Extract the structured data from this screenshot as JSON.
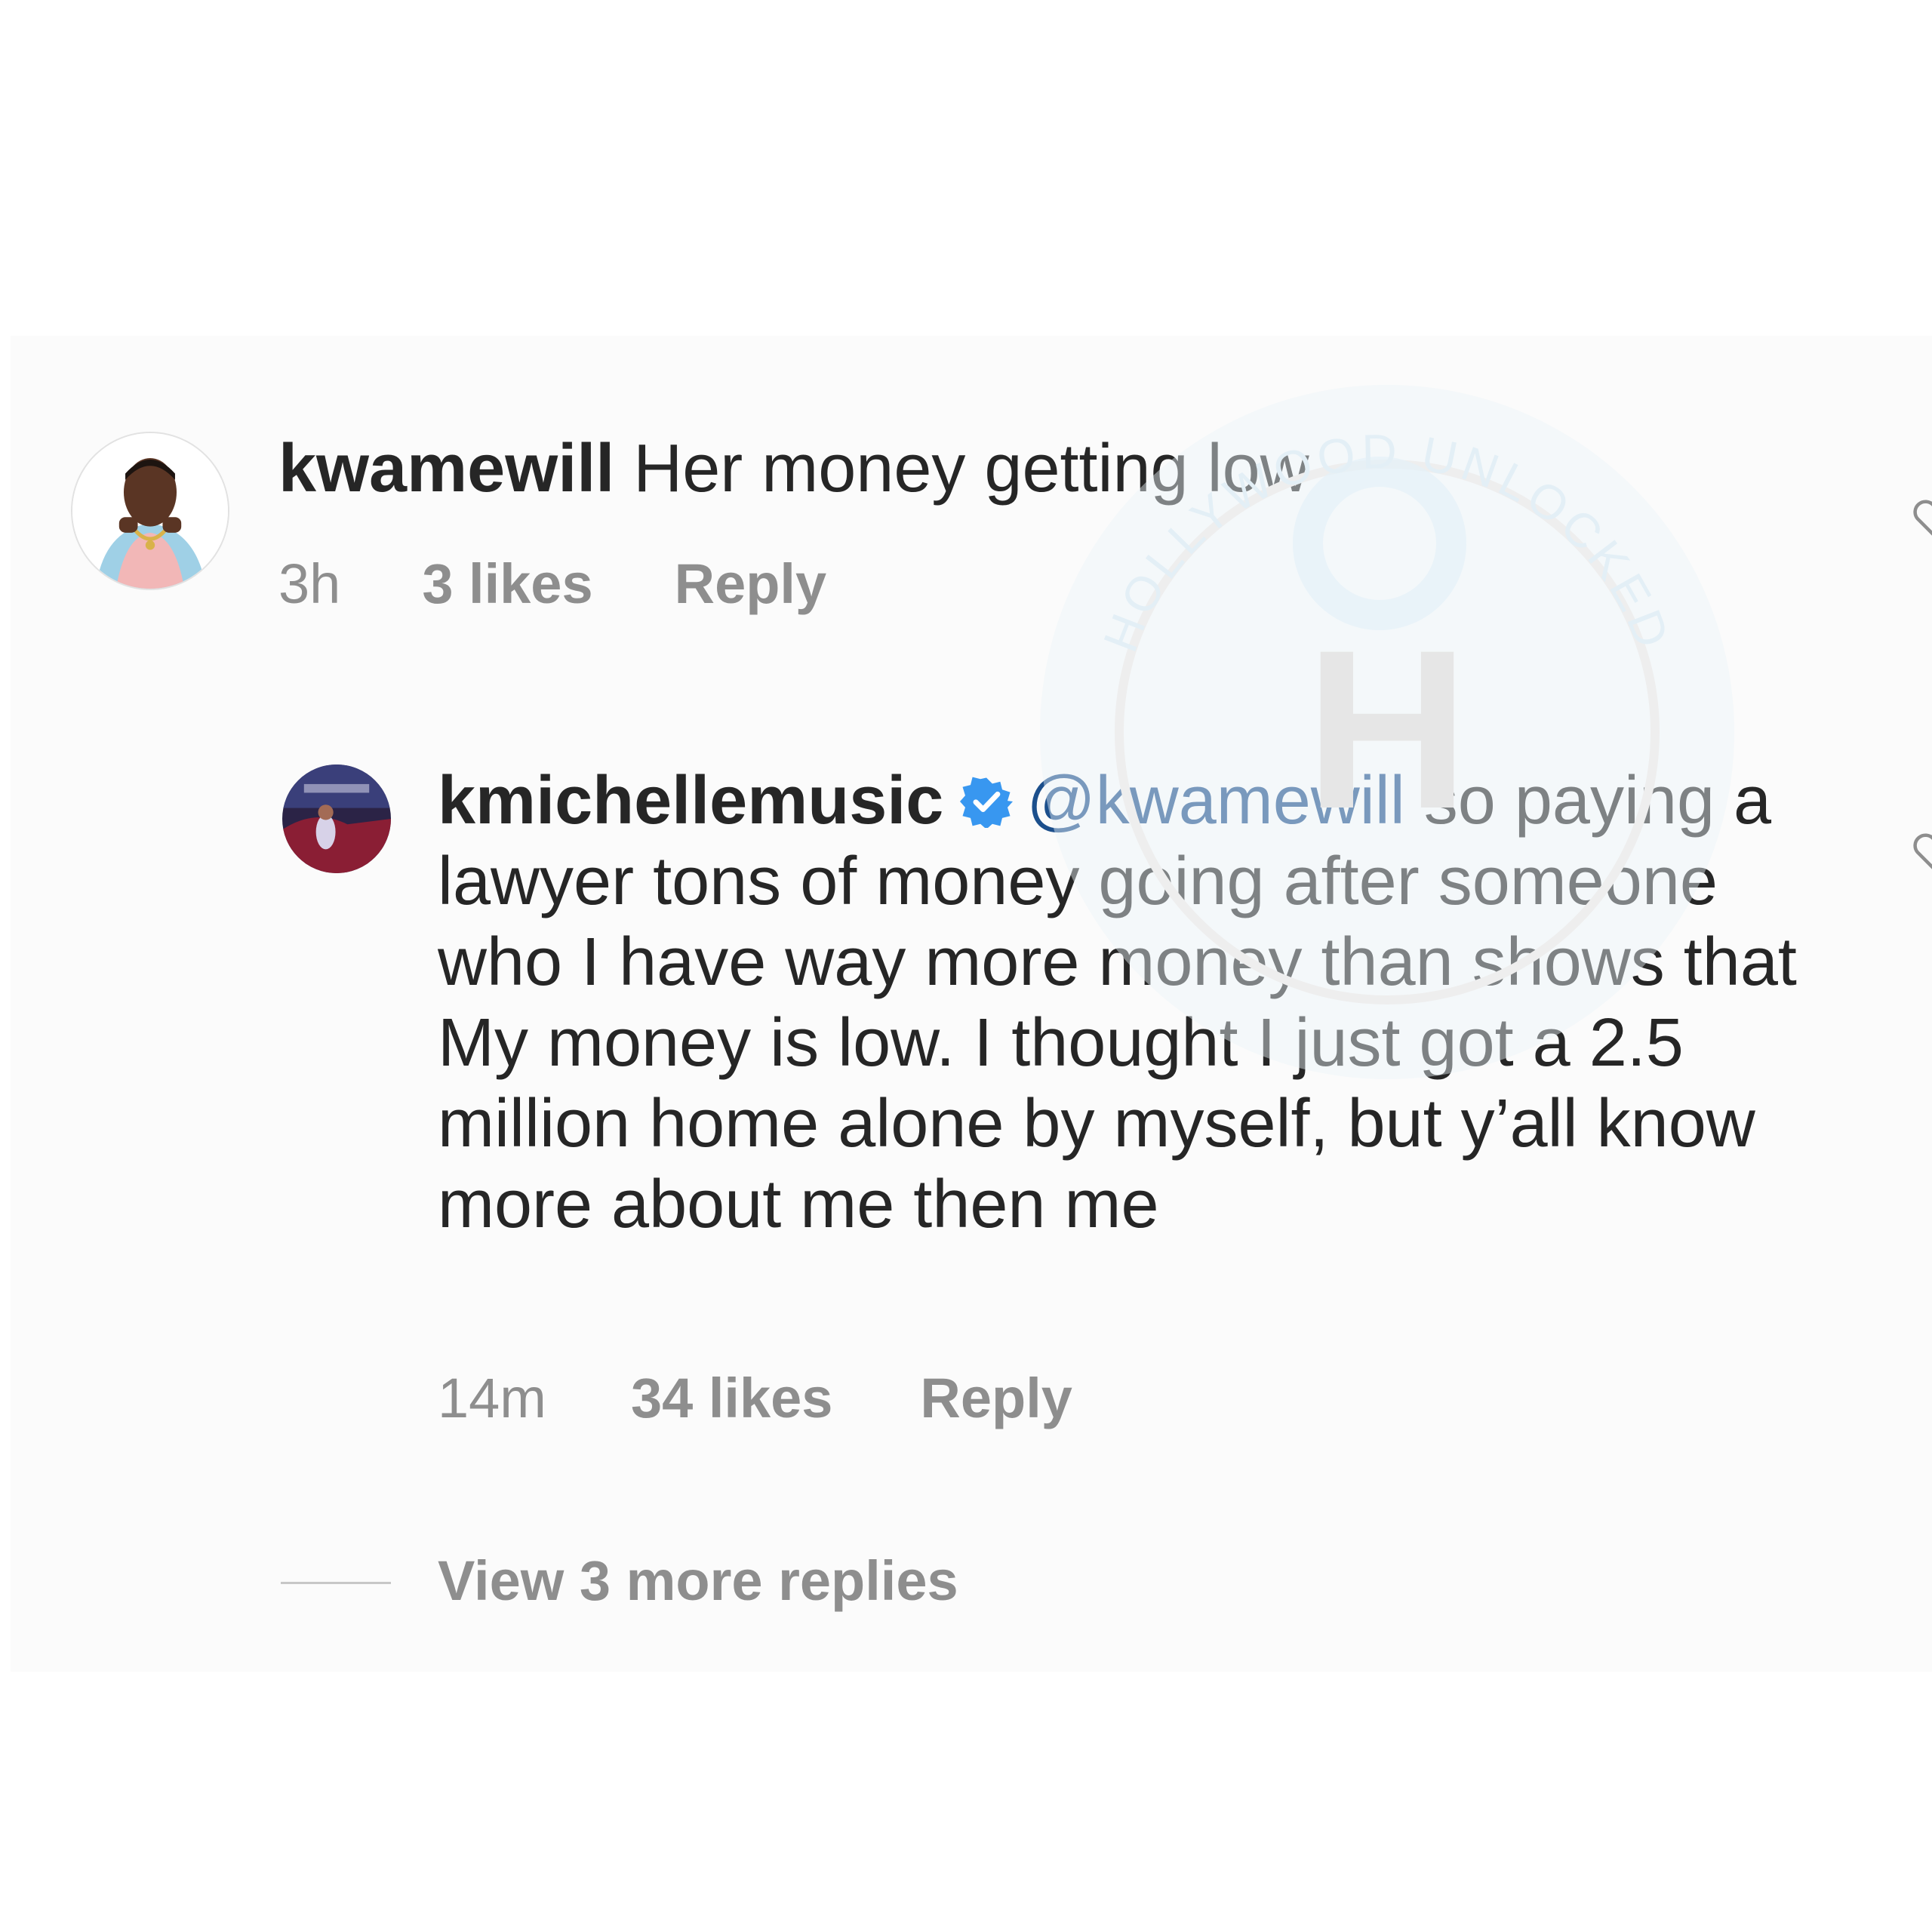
{
  "comment": {
    "username": "kwamewill",
    "text": "Her money getting low",
    "time": "3h",
    "likes": "3 likes",
    "reply_label": "Reply",
    "avatar_icon": "user-avatar-photo"
  },
  "reply": {
    "username": "kmichellemusic",
    "verified_icon": "verified-badge-icon",
    "mention": "@kwamewill",
    "text": "so paying a lawyer tons of money going after someone who I have way more money than shows that My money is low. I thought I just got a 2.5 million home alone by myself, but y’all know more about me then me",
    "time": "14m",
    "likes": "34 likes",
    "reply_label": "Reply",
    "avatar_icon": "user-avatar-photo"
  },
  "view_more": "View 3 more replies",
  "watermark": {
    "text": "HOLLYWOOD UNLOCKED",
    "letter": "H"
  },
  "colors": {
    "text": "#262626",
    "muted": "#8e8e8e",
    "mention": "#1c4f8c",
    "verified": "#3897f0"
  }
}
